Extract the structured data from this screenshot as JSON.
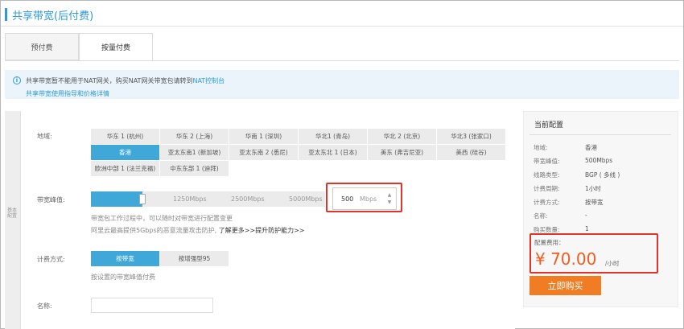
{
  "header": {
    "title": "共享带宽(后付费)"
  },
  "tabs": [
    {
      "label": "预付费",
      "active": false
    },
    {
      "label": "按量付费",
      "active": true
    }
  ],
  "notice": {
    "line1_text": "共享带宽暂不能用于NAT网关，购买NAT网关带宽包请转到",
    "line1_link": "NAT控制台",
    "line2_link": "共享带宽使用指导和价格详情"
  },
  "side_label": "基本配置",
  "region": {
    "label": "地域:",
    "selected": "香港",
    "options": [
      "华东 1 (杭州)",
      "华东 2 (上海)",
      "华南 1 (深圳)",
      "华北1 (青岛)",
      "华北 2 (北京)",
      "华北3 (张家口)",
      "香港",
      "亚太东南1 (新加坡)",
      "亚太东南 2 (悉尼)",
      "亚太东北 1 (日本)",
      "美东 (弗吉尼亚)",
      "美西 (硅谷)",
      "欧洲中部 1 (法兰克福)",
      "中东东部 1 (迪拜)"
    ]
  },
  "bandwidth": {
    "label": "带宽峰值:",
    "ticks": [
      "1250Mbps",
      "2500Mbps",
      "5000Mbps"
    ],
    "slider_fraction": 0.22,
    "value": "500",
    "unit": "Mbps",
    "hint1": "带宽包工作过程中，可以随时对带宽进行配置变更",
    "hint2": "阿里云最高提供5Gbps的恶意流量攻击防护,",
    "hint2_link": "了解更多>>提升防护能力>>"
  },
  "billing": {
    "label": "计费方式:",
    "options": [
      "按带宽",
      "按增强型95"
    ],
    "selected": "按带宽",
    "hint": "按设置的带宽峰值付费"
  },
  "name": {
    "label": "名称:",
    "value": "",
    "placeholder": ""
  },
  "summary": {
    "title": "当前配置",
    "rows": [
      {
        "k": "地域:",
        "v": "香港"
      },
      {
        "k": "带宽峰值:",
        "v": "500Mbps"
      },
      {
        "k": "线路类型:",
        "v": "BGP ( 多线 )"
      },
      {
        "k": "计费周期:",
        "v": "1小时"
      },
      {
        "k": "计费方式:",
        "v": "按带宽"
      },
      {
        "k": "名称:",
        "v": "-"
      },
      {
        "k": "购买数量:",
        "v": "1"
      }
    ],
    "fee_label": "配置费用：",
    "fee_amount": "¥ 70.00",
    "fee_unit": "/小时",
    "buy_label": "立即购买"
  },
  "colors": {
    "accent": "#2e9ad6",
    "selected": "#3fa8d8",
    "price": "#f25d1c",
    "buy": "#f07c24",
    "highlight": "#e0342a"
  }
}
